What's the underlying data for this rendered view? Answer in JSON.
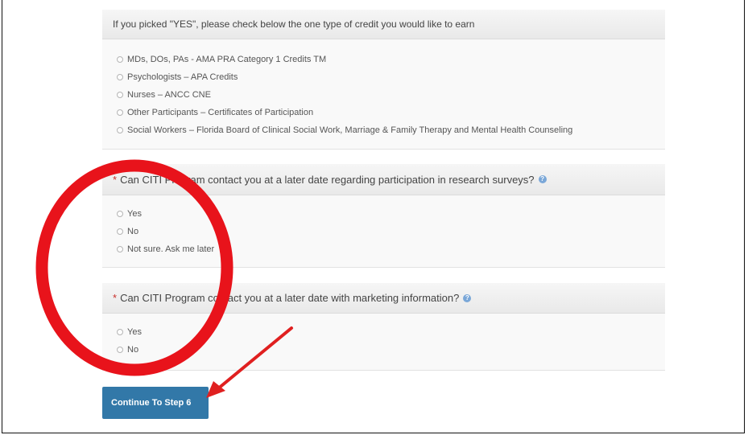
{
  "credit_section": {
    "question": "If you picked \"YES\", please check below the one type of credit you would like to earn",
    "options": [
      "MDs, DOs, PAs - AMA PRA Category 1 Credits TM",
      "Psychologists – APA Credits",
      "Nurses – ANCC CNE",
      "Other Participants – Certificates of Participation",
      "Social Workers – Florida Board of Clinical Social Work, Marriage & Family Therapy and Mental Health Counseling"
    ]
  },
  "survey_section": {
    "required_mark": "*",
    "question": "Can CITI Program contact you at a later date regarding participation in research surveys?",
    "help_glyph": "?",
    "options": [
      "Yes",
      "No",
      "Not sure. Ask me later"
    ]
  },
  "marketing_section": {
    "required_mark": "*",
    "question": "Can CITI Program contact you at a later date with marketing information?",
    "help_glyph": "?",
    "options": [
      "Yes",
      "No"
    ]
  },
  "continue_button": {
    "label": "Continue To  Step 6"
  },
  "annotation": {
    "circle_color": "#e8131b",
    "arrow_color": "#e02020"
  },
  "icons": {
    "help": "question-circle-icon",
    "radio": "radio-unchecked-icon"
  }
}
